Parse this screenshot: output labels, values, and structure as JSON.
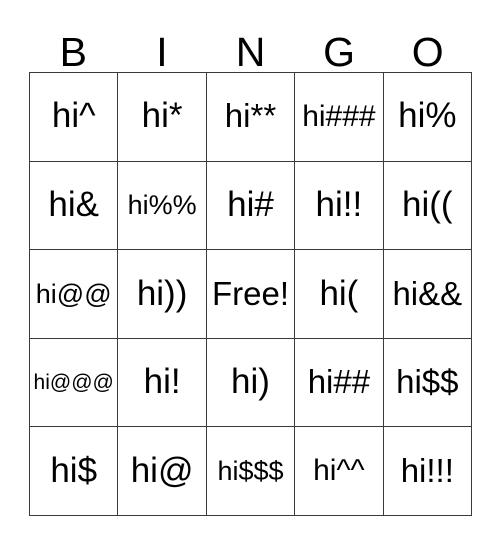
{
  "card": {
    "title": "BINGO",
    "header_letters": [
      "B",
      "I",
      "N",
      "G",
      "O"
    ],
    "free_space_label": "Free!",
    "grid_size": "5x5",
    "border_color": "#3a3a3a",
    "background_color": "#ffffff",
    "text_color": "#000000",
    "rows": [
      [
        {
          "text": "hi^",
          "size": "fs-xl"
        },
        {
          "text": "hi*",
          "size": "fs-xl"
        },
        {
          "text": "hi**",
          "size": "fs-lg"
        },
        {
          "text": "hi###",
          "size": "fs-md"
        },
        {
          "text": "hi%",
          "size": "fs-xl"
        }
      ],
      [
        {
          "text": "hi&",
          "size": "fs-xl"
        },
        {
          "text": "hi%%",
          "size": "fs-sm"
        },
        {
          "text": "hi#",
          "size": "fs-xl"
        },
        {
          "text": "hi!!",
          "size": "fs-xl"
        },
        {
          "text": "hi((",
          "size": "fs-xl"
        }
      ],
      [
        {
          "text": "hi@@",
          "size": "fs-sm"
        },
        {
          "text": "hi))",
          "size": "fs-xl"
        },
        {
          "text": "Free!",
          "size": "fs-lg"
        },
        {
          "text": "hi(",
          "size": "fs-xl"
        },
        {
          "text": "hi&&",
          "size": "fs-lg"
        }
      ],
      [
        {
          "text": "hi@@@",
          "size": "fs-xs"
        },
        {
          "text": "hi!",
          "size": "fs-xl"
        },
        {
          "text": "hi)",
          "size": "fs-xl"
        },
        {
          "text": "hi##",
          "size": "fs-lg"
        },
        {
          "text": "hi$$",
          "size": "fs-lg"
        }
      ],
      [
        {
          "text": "hi$",
          "size": "fs-xl"
        },
        {
          "text": "hi@",
          "size": "fs-xl"
        },
        {
          "text": "hi$$$",
          "size": "fs-sm"
        },
        {
          "text": "hi^^",
          "size": "fs-md"
        },
        {
          "text": "hi!!!",
          "size": "fs-lg"
        }
      ]
    ]
  }
}
